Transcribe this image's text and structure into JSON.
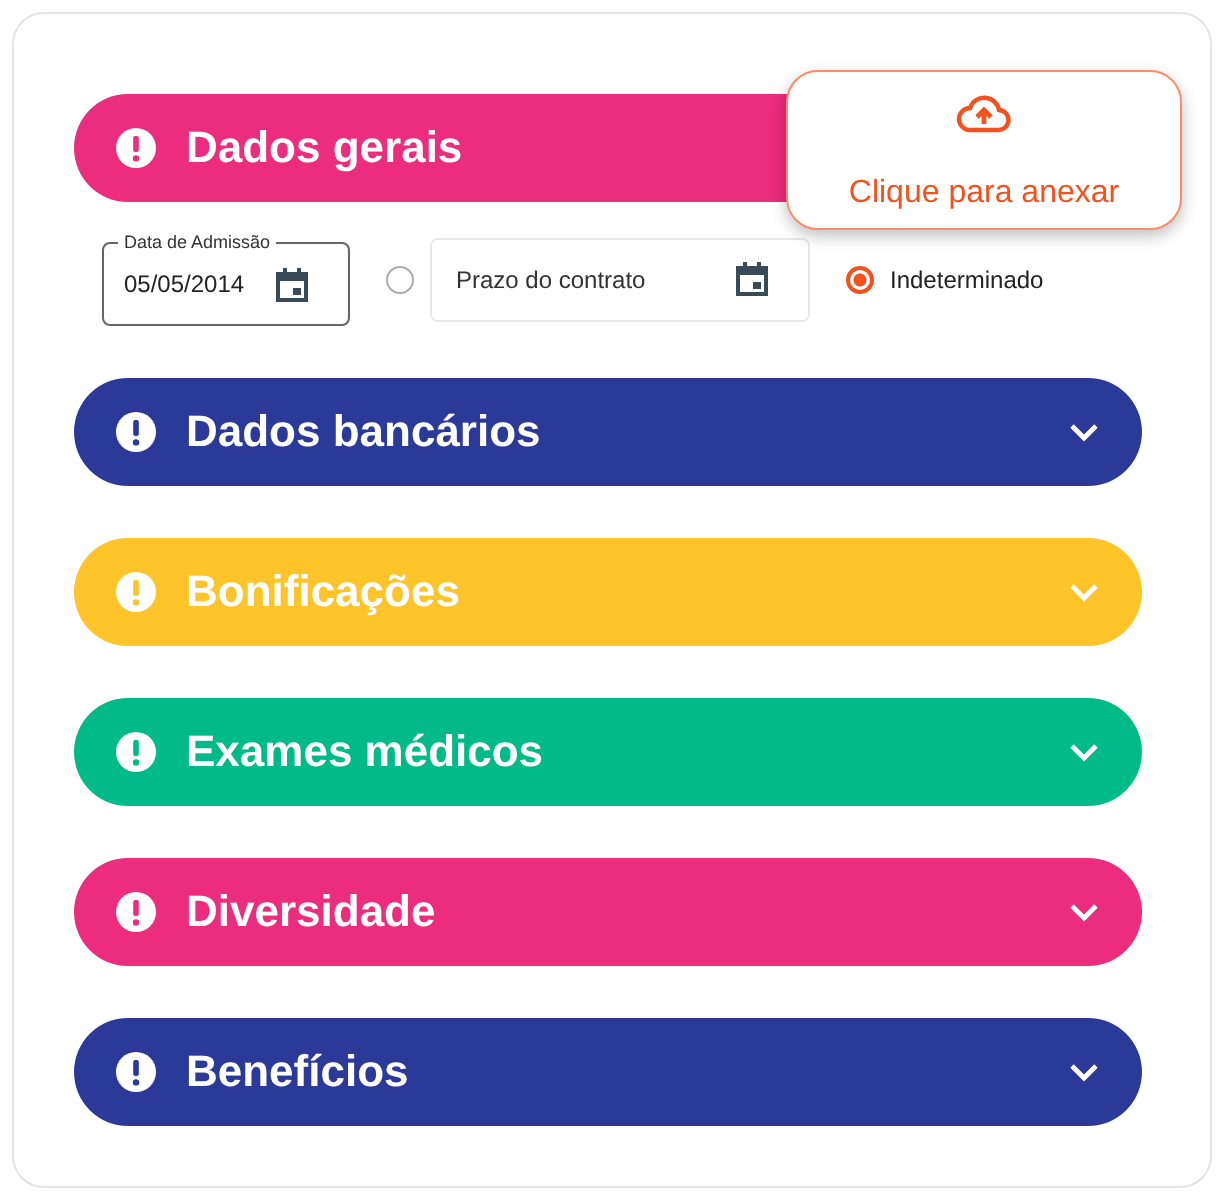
{
  "sections": [
    {
      "title": "Dados gerais",
      "color": "#ec2c7c",
      "expanded": true
    },
    {
      "title": "Dados bancários",
      "color": "#2b3a99",
      "expanded": false
    },
    {
      "title": "Bonificações",
      "color": "#fec42a",
      "expanded": false
    },
    {
      "title": "Exames médicos",
      "color": "#00bb87",
      "expanded": false
    },
    {
      "title": "Diversidade",
      "color": "#ec2c7c",
      "expanded": false
    },
    {
      "title": "Benefícios",
      "color": "#2b3a99",
      "expanded": false
    }
  ],
  "admission_field": {
    "label": "Data de Admissão",
    "value": "05/05/2014"
  },
  "contract_options": [
    {
      "kind": "date",
      "placeholder": "Prazo do contrato",
      "selected": false
    },
    {
      "kind": "label",
      "label": "Indeterminado",
      "selected": true
    }
  ],
  "upload": {
    "label": "Clique para anexar"
  }
}
